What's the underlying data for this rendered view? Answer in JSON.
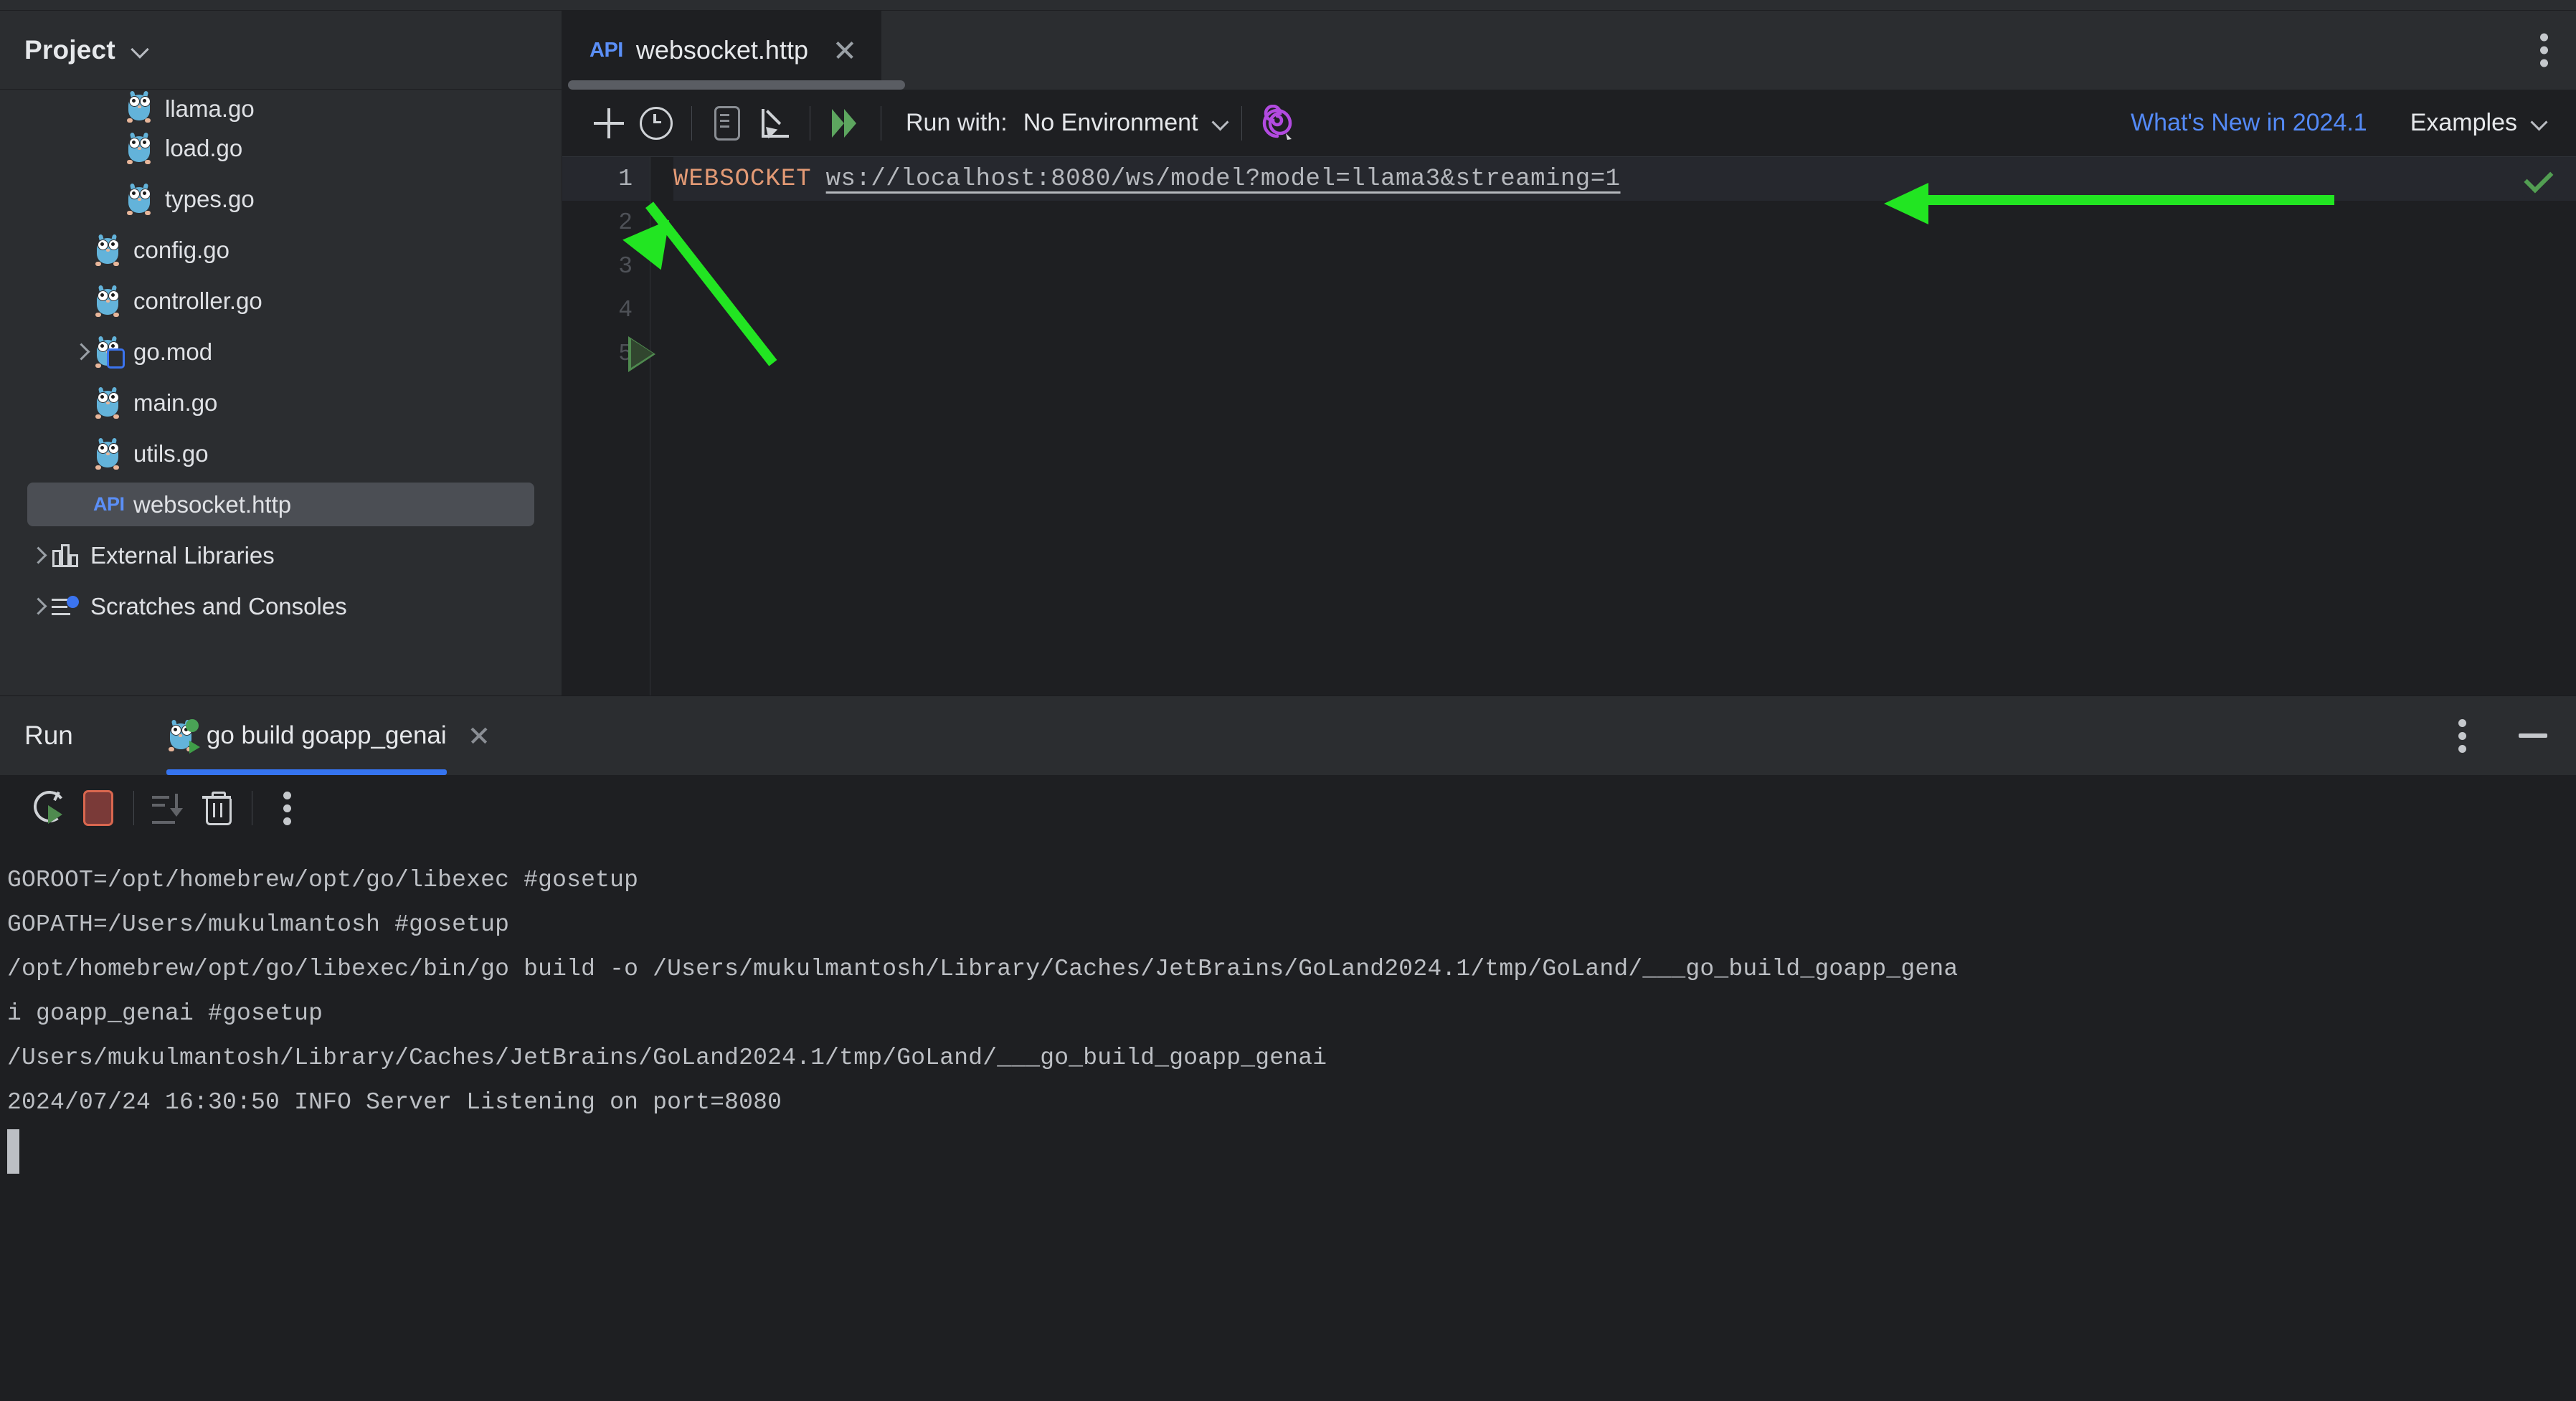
{
  "sidebar": {
    "title": "Project",
    "chevron_icon": "chevron-down-icon",
    "items": [
      {
        "label": "llama.go",
        "icon": "go-file-icon",
        "indent": 2,
        "twisty": "none",
        "selected": false,
        "clipped": true
      },
      {
        "label": "load.go",
        "icon": "go-file-icon",
        "indent": 2,
        "twisty": "none",
        "selected": false,
        "clipped": false
      },
      {
        "label": "types.go",
        "icon": "go-file-icon",
        "indent": 2,
        "twisty": "none",
        "selected": false,
        "clipped": false
      },
      {
        "label": "config.go",
        "icon": "go-file-icon",
        "indent": 1,
        "twisty": "none",
        "selected": false,
        "clipped": false
      },
      {
        "label": "controller.go",
        "icon": "go-file-icon",
        "indent": 1,
        "twisty": "none",
        "selected": false,
        "clipped": false
      },
      {
        "label": "go.mod",
        "icon": "go-mod-file-icon",
        "indent": 1,
        "twisty": "closed",
        "selected": false,
        "clipped": false
      },
      {
        "label": "main.go",
        "icon": "go-file-icon",
        "indent": 1,
        "twisty": "none",
        "selected": false,
        "clipped": false
      },
      {
        "label": "utils.go",
        "icon": "go-file-icon",
        "indent": 1,
        "twisty": "none",
        "selected": false,
        "clipped": false
      },
      {
        "label": "websocket.http",
        "icon": "api-http-file-icon",
        "indent": 1,
        "twisty": "none",
        "selected": true,
        "clipped": false
      },
      {
        "label": "External Libraries",
        "icon": "library-icon",
        "indent": 0,
        "twisty": "closed",
        "selected": false,
        "clipped": false
      },
      {
        "label": "Scratches and Consoles",
        "icon": "scratches-icon",
        "indent": 0,
        "twisty": "closed",
        "selected": false,
        "clipped": false
      }
    ]
  },
  "editor": {
    "tab": {
      "icon": "api-http-file-icon",
      "icon_label": "API",
      "name": "websocket.http",
      "close_icon": "close-icon"
    },
    "window_menu_icon": "kebab-menu-icon",
    "toolbar": {
      "add_icon": "plus-icon",
      "history_icon": "clock-history-icon",
      "convert_icon": "document-icon",
      "import_icon": "import-arrow-icon",
      "run_all_icon": "run-all-icon",
      "run_with_label": "Run with:",
      "environment_value": "No Environment",
      "environment_chevron_icon": "chevron-down-icon",
      "ai_assistant_icon": "ai-spiral-icon",
      "whats_new_link": "What's New in 2024.1",
      "examples_label": "Examples",
      "examples_chevron_icon": "chevron-down-icon"
    },
    "line_numbers": [
      "1",
      "2",
      "3",
      "4",
      "5"
    ],
    "gutter_run_icon": "run-request-icon",
    "code": {
      "method": "WEBSOCKET",
      "url": "ws://localhost:8080/ws/model?model=llama3&streaming=1"
    },
    "inspection_icon": "inspection-ok-check-icon"
  },
  "run_panel": {
    "title": "Run",
    "tab": {
      "icon": "go-run-config-icon",
      "label": "go build goapp_genai",
      "close_icon": "close-icon"
    },
    "header_menu_icon": "kebab-menu-icon",
    "minimize_icon": "minimize-icon",
    "toolbar": {
      "rerun_icon": "rerun-icon",
      "stop_icon": "stop-icon",
      "scroll_end_icon": "scroll-to-end-icon",
      "clear_icon": "trash-clear-icon",
      "more_icon": "kebab-menu-icon"
    },
    "console_lines": [
      "GOROOT=/opt/homebrew/opt/go/libexec #gosetup",
      "GOPATH=/Users/mukulmantosh #gosetup",
      "/opt/homebrew/opt/go/libexec/bin/go build -o /Users/mukulmantosh/Library/Caches/JetBrains/GoLand2024.1/tmp/GoLand/___go_build_goapp_gena",
      "i goapp_genai #gosetup",
      "/Users/mukulmantosh/Library/Caches/JetBrains/GoLand2024.1/tmp/GoLand/___go_build_goapp_genai",
      "2024/07/24 16:30:50 INFO Server Listening on port=8080"
    ]
  },
  "annotations": {
    "arrow_url_icon": "green-arrow-left",
    "arrow_gutter_icon": "green-arrow-up-left",
    "color": "#22e522"
  }
}
